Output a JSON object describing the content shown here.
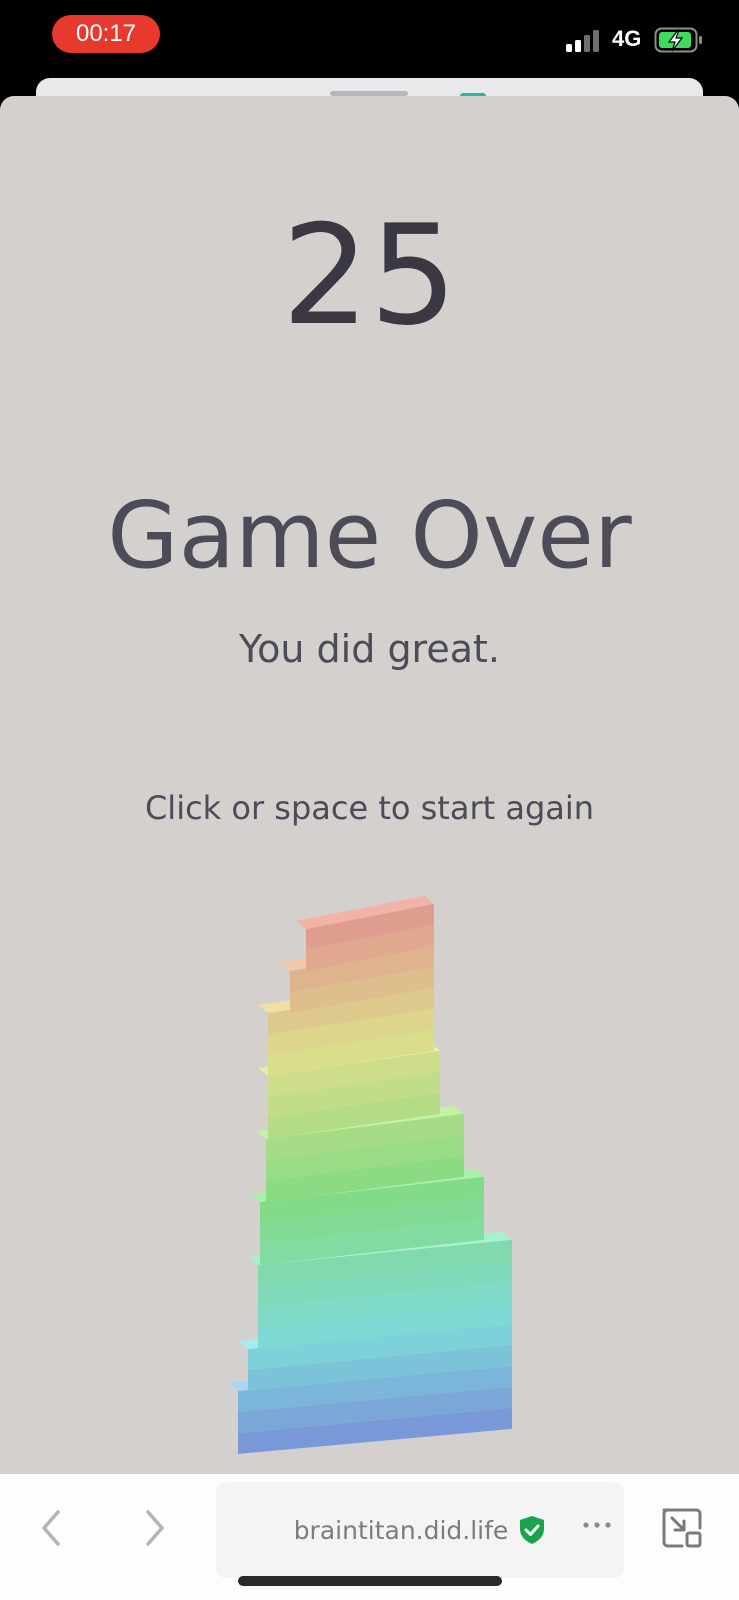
{
  "status_bar": {
    "time": "00:17",
    "network": "4G",
    "signal_bars": 4,
    "signal_bars_active": 2,
    "battery_icon": "battery-charging-icon"
  },
  "game": {
    "score": "25",
    "title": "Game Over",
    "subtitle": "You did great.",
    "instruction": "Click or space to start again",
    "background": "#d3d0ce",
    "text_color": "#4d4b58",
    "placed_blocks": 25
  },
  "browser": {
    "back_icon": "chevron-left-icon",
    "forward_icon": "chevron-right-icon",
    "url": "braintitan.did.life",
    "secure_icon": "shield-check-icon",
    "more_icon": "more-dots-icon",
    "minimize_icon": "minimize-window-icon"
  },
  "colors": {
    "timer_pill": "#e8392f",
    "secure_green": "#1aa34a",
    "tower_top": "#f0a190",
    "tower_bottom": "#7b9ccd"
  }
}
